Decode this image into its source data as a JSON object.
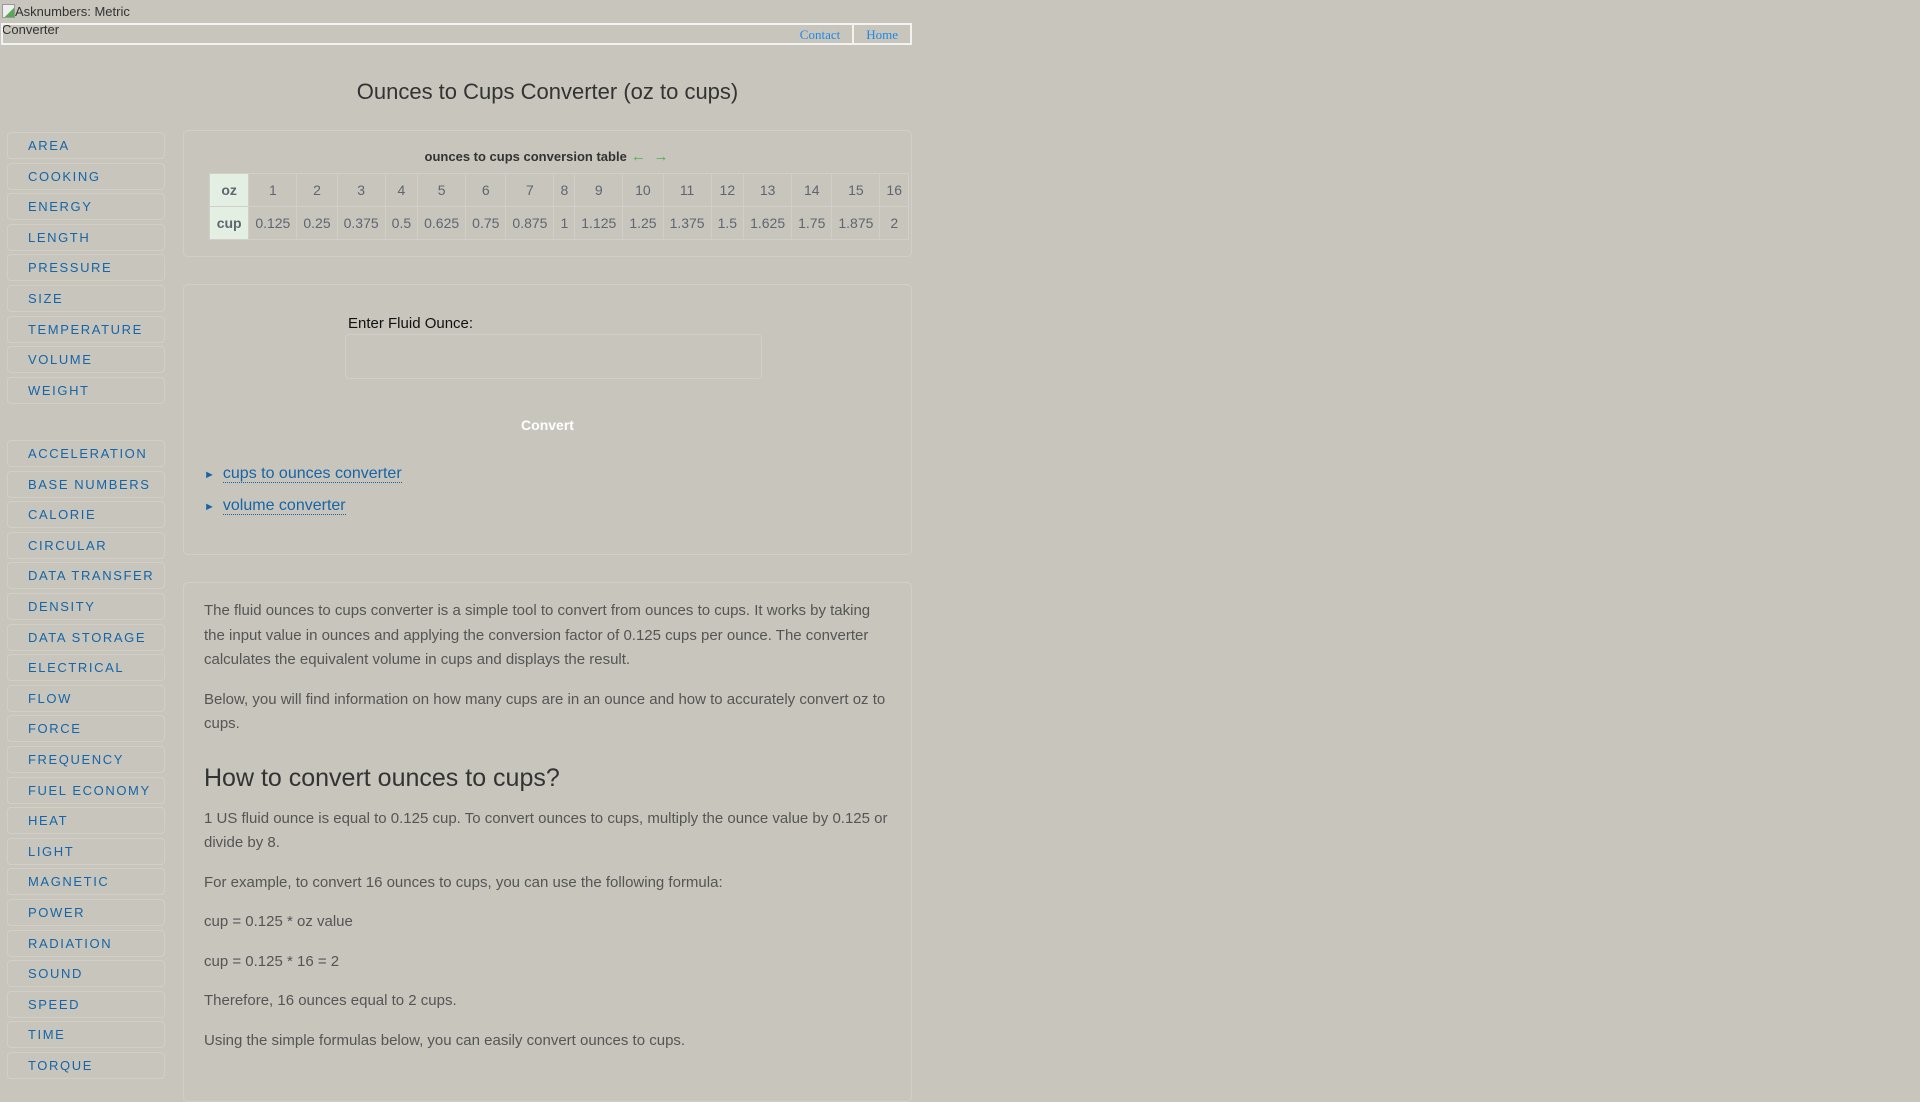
{
  "header": {
    "logo_alt": "Asknumbers: Metric Converter",
    "nav": [
      "Contact",
      "Home"
    ]
  },
  "page_title": "Ounces to Cups Converter (oz to cups)",
  "sidebar": {
    "group1": [
      "AREA",
      "COOKING",
      "ENERGY",
      "LENGTH",
      "PRESSURE",
      "SIZE",
      "TEMPERATURE",
      "VOLUME",
      "WEIGHT"
    ],
    "group2": [
      "ACCELERATION",
      "BASE NUMBERS",
      "CALORIE",
      "CIRCULAR",
      "DATA TRANSFER",
      "DENSITY",
      "DATA STORAGE",
      "ELECTRICAL",
      "FLOW",
      "FORCE",
      "FREQUENCY",
      "FUEL ECONOMY",
      "HEAT",
      "LIGHT",
      "MAGNETIC",
      "POWER",
      "RADIATION",
      "SOUND",
      "SPEED",
      "TIME",
      "TORQUE"
    ]
  },
  "table": {
    "caption": "ounces to cups conversion table",
    "arrow_left": "←",
    "arrow_right": "→",
    "row_oz_label": "oz",
    "row_cup_label": "cup",
    "oz": [
      "1",
      "2",
      "3",
      "4",
      "5",
      "6",
      "7",
      "8",
      "9",
      "10",
      "11",
      "12",
      "13",
      "14",
      "15",
      "16"
    ],
    "cup": [
      "0.125",
      "0.25",
      "0.375",
      "0.5",
      "0.625",
      "0.75",
      "0.875",
      "1",
      "1.125",
      "1.25",
      "1.375",
      "1.5",
      "1.625",
      "1.75",
      "1.875",
      "2"
    ]
  },
  "form": {
    "label": "Enter Fluid Ounce:",
    "value": "",
    "button": "Convert"
  },
  "links": [
    "cups to ounces converter",
    "volume converter"
  ],
  "article": {
    "p1": "The fluid ounces to cups converter is a simple tool to convert from ounces to cups. It works by taking the input value in ounces and applying the conversion factor of 0.125 cups per ounce. The converter calculates the equivalent volume in cups and displays the result.",
    "p2": "Below, you will find information on how many cups are in an ounce and how to accurately convert oz to cups.",
    "h2": "How to convert ounces to cups?",
    "p3": "1 US fluid ounce is equal to 0.125 cup. To convert ounces to cups, multiply the ounce value by 0.125 or divide by 8.",
    "p4": "For example, to convert 16 ounces to cups, you can use the following formula:",
    "p5": "cup = 0.125 * oz value",
    "p6": "cup = 0.125 * 16 = 2",
    "p7": "Therefore, 16 ounces equal to 2 cups.",
    "p8": "Using the simple formulas below, you can easily convert ounces to cups."
  }
}
